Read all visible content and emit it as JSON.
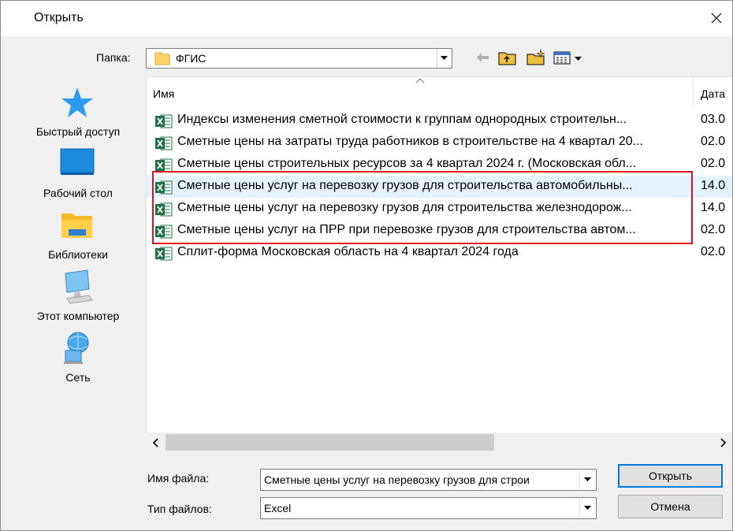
{
  "window": {
    "title": "Открыть"
  },
  "folder": {
    "label": "Папка:",
    "current": "ФГИС"
  },
  "toolbar": {
    "icons": [
      "back-arrow-icon",
      "up-folder-icon",
      "new-folder-icon",
      "view-menu-icon"
    ]
  },
  "places": [
    {
      "label": "Быстрый доступ",
      "icon": "quick-access-star-icon"
    },
    {
      "label": "Рабочий стол",
      "icon": "desktop-icon"
    },
    {
      "label": "Библиотеки",
      "icon": "libraries-icon"
    },
    {
      "label": "Этот компьютер",
      "icon": "this-pc-icon"
    },
    {
      "label": "Сеть",
      "icon": "network-icon"
    }
  ],
  "columns": {
    "name": "Имя",
    "date": "Дата"
  },
  "files": [
    {
      "name": "Индексы изменения сметной стоимости к группам однородных строительн...",
      "date": "03.0"
    },
    {
      "name": "Сметные цены на затраты труда работников в строительстве на 4 квартал 20...",
      "date": "02.0"
    },
    {
      "name": "Сметные цены строительных ресурсов за 4 квартал 2024 г. (Московская обл...",
      "date": "02.0"
    },
    {
      "name": "Сметные цены услуг на перевозку грузов для строительства автомобильны...",
      "date": "14.0"
    },
    {
      "name": "Сметные цены услуг на перевозку грузов для строительства железнодорож...",
      "date": "14.0"
    },
    {
      "name": "Сметные цены услуг на ПРР при перевозке грузов для строительства автом...",
      "date": "02.0"
    },
    {
      "name": "Сплит-форма Московская область на 4 квартал 2024 года",
      "date": "02.0"
    }
  ],
  "filename": {
    "label": "Имя файла:",
    "value": "Сметные цены услуг на перевозку грузов для строи"
  },
  "filetype": {
    "label": "Тип файлов:",
    "value": "Excel"
  },
  "buttons": {
    "open": "Открыть",
    "cancel": "Отмена"
  },
  "colors": {
    "highlight": "#e0101e",
    "selected_row": "#e5f3ff",
    "excel_green": "#1e7145",
    "accent": "#0078d7"
  }
}
